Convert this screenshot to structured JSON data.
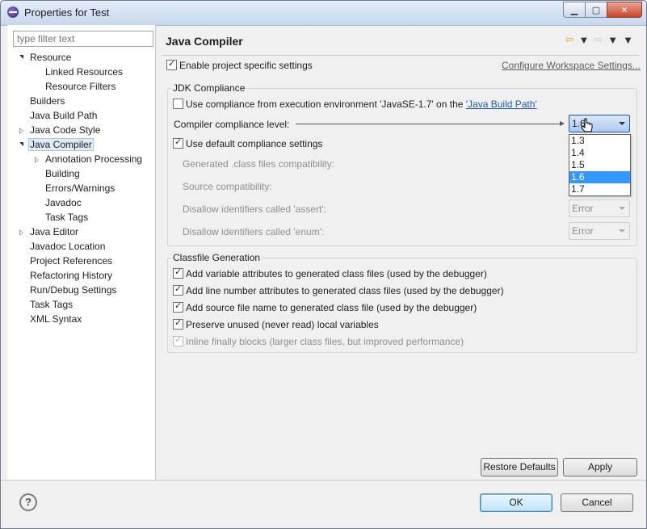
{
  "window": {
    "title": "Properties for Test",
    "controls": {
      "minimize": "▁",
      "maximize": "▢",
      "close": "✕"
    }
  },
  "filter": {
    "placeholder": "type filter text"
  },
  "tree": [
    {
      "label": "Resource",
      "level": 0,
      "state": "expanded"
    },
    {
      "label": "Linked Resources",
      "level": 1,
      "state": "leaf"
    },
    {
      "label": "Resource Filters",
      "level": 1,
      "state": "leaf"
    },
    {
      "label": "Builders",
      "level": 0,
      "state": "leaf"
    },
    {
      "label": "Java Build Path",
      "level": 0,
      "state": "leaf"
    },
    {
      "label": "Java Code Style",
      "level": 0,
      "state": "collapsed"
    },
    {
      "label": "Java Compiler",
      "level": 0,
      "state": "expanded",
      "selected": true
    },
    {
      "label": "Annotation Processing",
      "level": 1,
      "state": "collapsed"
    },
    {
      "label": "Building",
      "level": 1,
      "state": "leaf"
    },
    {
      "label": "Errors/Warnings",
      "level": 1,
      "state": "leaf"
    },
    {
      "label": "Javadoc",
      "level": 1,
      "state": "leaf"
    },
    {
      "label": "Task Tags",
      "level": 1,
      "state": "leaf"
    },
    {
      "label": "Java Editor",
      "level": 0,
      "state": "collapsed"
    },
    {
      "label": "Javadoc Location",
      "level": 0,
      "state": "leaf"
    },
    {
      "label": "Project References",
      "level": 0,
      "state": "leaf"
    },
    {
      "label": "Refactoring History",
      "level": 0,
      "state": "leaf"
    },
    {
      "label": "Run/Debug Settings",
      "level": 0,
      "state": "leaf"
    },
    {
      "label": "Task Tags",
      "level": 0,
      "state": "leaf"
    },
    {
      "label": "XML Syntax",
      "level": 0,
      "state": "leaf"
    }
  ],
  "page": {
    "title": "Java Compiler",
    "enable_project_settings": "Enable project specific settings",
    "configure_workspace_link": "Configure Workspace Settings..."
  },
  "jdk": {
    "group_title": "JDK Compliance",
    "use_env_prefix": "Use compliance from execution environment 'JavaSE-1.7' on the ",
    "use_env_link": "'Java Build Path'",
    "compliance_label": "Compiler compliance level:",
    "compliance_value": "1.6",
    "use_default": "Use default compliance settings",
    "generated_compat": "Generated .class files compatibility:",
    "source_compat": "Source compatibility:",
    "disallow_assert": "Disallow identifiers called 'assert':",
    "disallow_enum": "Disallow identifiers called 'enum':",
    "assert_value": "Error",
    "enum_value": "Error",
    "options": [
      "1.3",
      "1.4",
      "1.5",
      "1.6",
      "1.7"
    ],
    "selected_option": "1.6"
  },
  "classfile": {
    "group_title": "Classfile Generation",
    "variable_attrs": "Add variable attributes to generated class files (used by the debugger)",
    "line_numbers": "Add line number attributes to generated class files (used by the debugger)",
    "source_name": "Add source file name to generated class file (used by the debugger)",
    "preserve_unused": "Preserve unused (never read) local variables",
    "inline_finally": "Inline finally blocks (larger class files, but improved performance)"
  },
  "buttons": {
    "restore_defaults": "Restore Defaults",
    "apply": "Apply",
    "ok": "OK",
    "cancel": "Cancel",
    "help": "?"
  },
  "colors": {
    "title_bar": "#c6d7ec",
    "selection": "#3399ff",
    "link": "#1b5fb5",
    "nav_back": "#e3a82b"
  }
}
